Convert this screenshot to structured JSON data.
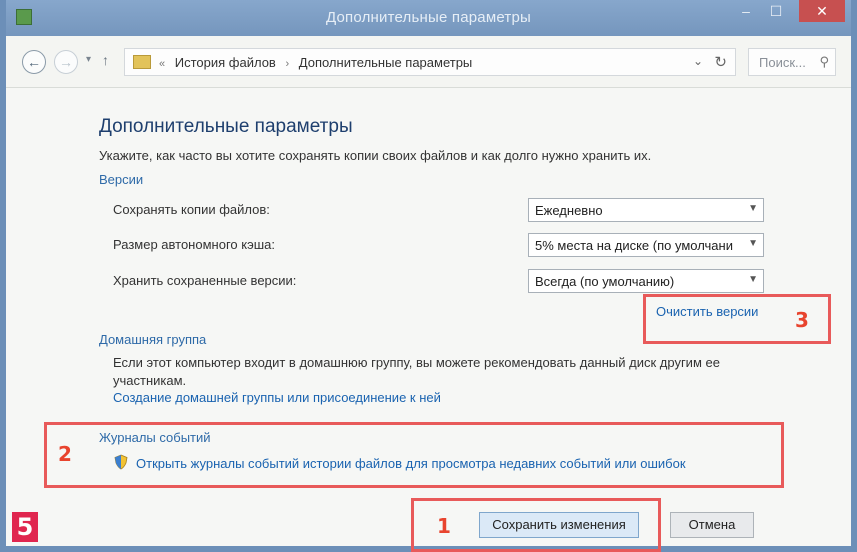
{
  "window": {
    "title": "Дополнительные параметры"
  },
  "nav": {
    "back_icon": "←",
    "forward_icon": "→",
    "breadcrumbs": [
      "История файлов",
      "Дополнительные параметры"
    ],
    "search_placeholder": "Поиск...",
    "prefix": "«"
  },
  "page": {
    "title": "Дополнительные параметры",
    "description": "Укажите, как часто вы хотите сохранять копии своих файлов и как долго нужно хранить их."
  },
  "versions": {
    "header": "Версии",
    "rows": [
      {
        "label": "Сохранять копии файлов:",
        "value": "Ежедневно"
      },
      {
        "label": "Размер автономного кэша:",
        "value": "5% места на диске (по умолчани"
      },
      {
        "label": "Хранить сохраненные версии:",
        "value": "Всегда (по умолчанию)"
      }
    ],
    "clean_link": "Очистить версии"
  },
  "homegroup": {
    "header": "Домашняя группа",
    "text": "Если этот компьютер входит в домашнюю группу, вы можете рекомендовать данный диск другим ее участникам.",
    "link": "Создание домашней группы или присоединение к ней"
  },
  "eventlogs": {
    "header": "Журналы событий",
    "link": "Открыть журналы событий истории файлов для просмотра недавних событий или ошибок"
  },
  "buttons": {
    "save": "Сохранить изменения",
    "cancel": "Отмена"
  },
  "annotations": {
    "n1": "1",
    "n2": "2",
    "n3": "3",
    "badge": "5"
  },
  "colors": {
    "highlight": "#e85a5a",
    "link": "#1a63b0",
    "badge": "#e0264f"
  }
}
